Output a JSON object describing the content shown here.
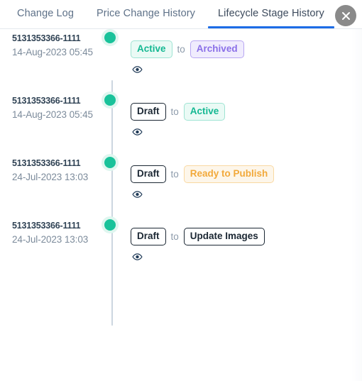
{
  "tabs": [
    {
      "label": "Change Log",
      "active": false
    },
    {
      "label": "Price Change History",
      "active": false
    },
    {
      "label": "Lifecycle Stage History",
      "active": true
    }
  ],
  "close_button": {
    "icon": "close-icon",
    "label": "×"
  },
  "colors": {
    "active_tab_underline": "#1d6ce6",
    "timeline_dot": "#19c29a",
    "timeline_line": "#ccd6e0",
    "badge_green": "#14b892",
    "badge_purple": "#8a6fe8",
    "badge_orange": "#f2a93b",
    "badge_dark": "#1b2733",
    "close_button_bg": "#8a8a8a"
  },
  "timeline": {
    "to_word": "to",
    "view_icon": "eye-icon",
    "entries": [
      {
        "id": "5131353366-1111",
        "date": "14-Aug-2023 05:45",
        "from_stage": "Active",
        "from_style": "green",
        "to_stage": "Archived",
        "to_style": "purple"
      },
      {
        "id": "5131353366-1111",
        "date": "14-Aug-2023 05:45",
        "from_stage": "Draft",
        "from_style": "dark",
        "to_stage": "Active",
        "to_style": "green"
      },
      {
        "id": "5131353366-1111",
        "date": "24-Jul-2023 13:03",
        "from_stage": "Draft",
        "from_style": "dark",
        "to_stage": "Ready to Publish",
        "to_style": "orange"
      },
      {
        "id": "5131353366-1111",
        "date": "24-Jul-2023 13:03",
        "from_stage": "Draft",
        "from_style": "dark",
        "to_stage": "Update Images",
        "to_style": "dark"
      }
    ]
  }
}
